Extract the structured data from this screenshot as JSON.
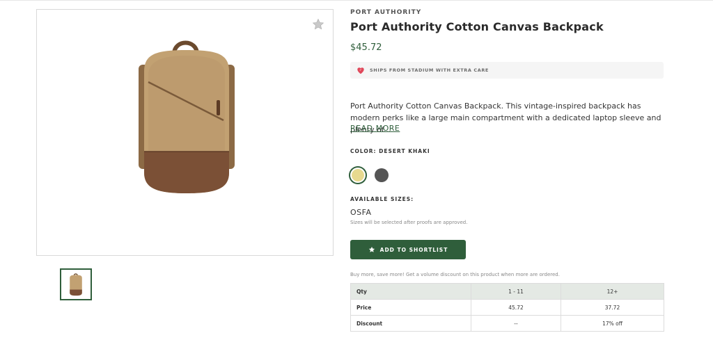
{
  "product": {
    "brand": "PORT AUTHORITY",
    "title": "Port Authority Cotton Canvas Backpack",
    "price": "$45.72",
    "shipping_banner": "SHIPS FROM STADIUM WITH EXTRA CARE",
    "description": "Port Authority Cotton Canvas Backpack. This vintage-inspired backpack has modern perks like a large main compartment with a dedicated laptop sleeve and plenty of...",
    "read_more": "READ MORE",
    "color_label": "COLOR: DESERT KHAKI",
    "colors": [
      {
        "name": "desert-khaki",
        "hex": "#e7d98f",
        "selected": true
      },
      {
        "name": "grey",
        "hex": "#555555",
        "selected": false
      }
    ],
    "sizes_label": "AVAILABLE SIZES:",
    "size": "OSFA",
    "size_note": "Sizes will be selected after proofs are approved.",
    "shortlist_button": "ADD TO SHORTLIST",
    "bulk_note": "Buy more, save more! Get a volume discount on this product when more are ordered."
  },
  "pricing_table": {
    "header": [
      "Qty",
      "1 - 11",
      "12+"
    ],
    "rows": [
      [
        "Price",
        "45.72",
        "37.72"
      ],
      [
        "Discount",
        "--",
        "17% off"
      ]
    ]
  },
  "icons": {
    "favorite": "star-icon",
    "shipping": "heart-icon",
    "shortlist": "star-icon"
  },
  "theme": {
    "accent": "#2f5e3b",
    "shipping_icon": "#e0485a"
  }
}
